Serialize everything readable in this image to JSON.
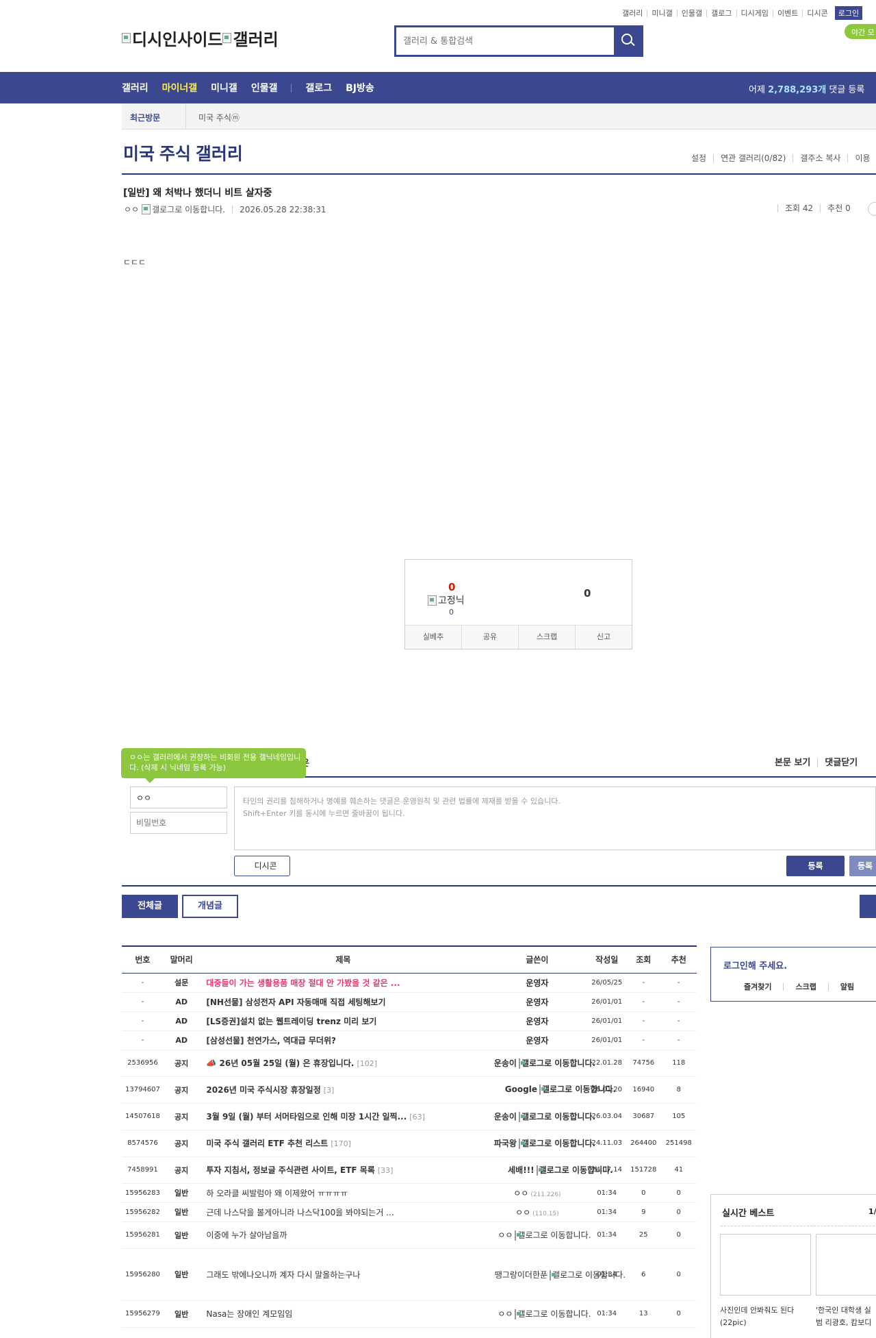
{
  "util_links": [
    "갤러리",
    "미니갤",
    "인물갤",
    "갤로그",
    "디시게임",
    "이벤트",
    "디시콘"
  ],
  "login_label": "로그인",
  "night_mode": "야간 모",
  "logo_text": "디시인사이드",
  "logo_text2": "갤러리",
  "search": {
    "placeholder": "갤러리 & 통합검색"
  },
  "gnb": {
    "items": [
      "갤러리",
      "마이너갤",
      "미니갤",
      "인물갤",
      "갤로그",
      "BJ방송"
    ],
    "yesterday_prefix": "어제",
    "yesterday_count": "2,788,293개",
    "yesterday_suffix": "댓글 등록"
  },
  "recent_visit": {
    "label": "최근방문",
    "item": "미국 주식ⓜ"
  },
  "gallery": {
    "title": "미국 주식 갤러리",
    "tools": [
      "설정",
      "연관 갤러리(0/82)",
      "갤주소 복사",
      "이용"
    ]
  },
  "post": {
    "title": "[일반] 왜 처박나 했더니 비트 살자중",
    "author": "ㅇㅇ",
    "author_img_alt": "갤로그로 이동합니다.",
    "date": "2026.05.28 22:38:31",
    "views": "조회 42",
    "recommend": "추천 0",
    "body": "ㄷㄷㄷ"
  },
  "recommend_box": {
    "up": "0",
    "fixed_label": "고정닉",
    "fixed_count": "0",
    "down": "0",
    "buttons": [
      "실베추",
      "공유",
      "스크랩",
      "신고"
    ]
  },
  "comment": {
    "partial_header": "은",
    "tooltip": "ㅇㅇ는 갤러리에서 권장하는 비회원 전용 갤닉네임입니다. (삭제 시 닉네임 등록 가능)",
    "header_right": [
      "본문 보기",
      "댓글닫기"
    ],
    "nick_value": "ㅇㅇ",
    "pw_placeholder": "비밀번호",
    "notice_line1": "타인의 권리를 침해하거나 명예를 훼손하는 댓글은 운영원칙 및 관련 법률에 제재를 받을 수 있습니다.",
    "notice_line2": "Shift+Enter 키를 동시에 누르면 줄바꿈이 됩니다.",
    "dccon": "디시콘",
    "submit": "등록",
    "submit2": "등록"
  },
  "tabs": [
    "전체글",
    "개념글"
  ],
  "table": {
    "headers": [
      "번호",
      "말머리",
      "제목",
      "글쓴이",
      "작성일",
      "조회",
      "추천"
    ],
    "rows": [
      {
        "num": "-",
        "head": "설문",
        "subject": "대중들이 가는 생활용품 매장 절대 안 가봤을 것 같은 ...",
        "reply": "",
        "writer": "운영자",
        "wimg": "",
        "ip": "",
        "date": "26/05/25",
        "views": "-",
        "rec": "-",
        "type": "survey"
      },
      {
        "num": "-",
        "head": "AD",
        "subject": "[NH선물] 삼성전자 API 자동매매 직접 세팅해보기",
        "reply": "",
        "writer": "운영자",
        "wimg": "",
        "ip": "",
        "date": "26/01/01",
        "views": "-",
        "rec": "-",
        "type": "ad"
      },
      {
        "num": "-",
        "head": "AD",
        "subject": "[LS증권]설치 없는 웹트레이딩 trenz 미리 보기",
        "reply": "",
        "writer": "운영자",
        "wimg": "",
        "ip": "",
        "date": "26/01/01",
        "views": "-",
        "rec": "-",
        "type": "ad"
      },
      {
        "num": "-",
        "head": "AD",
        "subject": "[삼성선물] 천연가스, 역대급 무더위?",
        "reply": "",
        "writer": "운영자",
        "wimg": "",
        "ip": "",
        "date": "26/01/01",
        "views": "-",
        "rec": "-",
        "type": "ad"
      },
      {
        "num": "2536956",
        "head": "공지",
        "subject": "📣 26년 05월 25일 (월) 은 휴장입니다.",
        "reply": "[102]",
        "writer": "운송이",
        "wimg": "갤로그로 이동합니다.",
        "ip": "",
        "date": "22.01.28",
        "views": "74756",
        "rec": "118",
        "type": "notice"
      },
      {
        "num": "13794607",
        "head": "공지",
        "subject": "2026년 미국 주식시장 휴장일정",
        "reply": "[3]",
        "writer": "Google",
        "wimg": "갤로그로 이동합니다.",
        "ip": "",
        "date": "26.01.20",
        "views": "16940",
        "rec": "8",
        "type": "notice"
      },
      {
        "num": "14507618",
        "head": "공지",
        "subject": "3월 9일 (월) 부터 서머타임으로 인해 미장 1시간 일찍...",
        "reply": "[63]",
        "writer": "운송이",
        "wimg": "갤로그로 이동합니다.",
        "ip": "",
        "date": "26.03.04",
        "views": "30687",
        "rec": "105",
        "type": "notice"
      },
      {
        "num": "8574576",
        "head": "공지",
        "subject": "미국 주식 갤러리 ETF 추천 리스트",
        "reply": "[170]",
        "writer": "파국왕",
        "wimg": "갤로그로 이동합니다.",
        "ip": "",
        "date": "24.11.03",
        "views": "264400",
        "rec": "251498",
        "type": "notice"
      },
      {
        "num": "7458991",
        "head": "공지",
        "subject": "투자 지침서, 정보글 주식관련 사이트, ETF 목록",
        "reply": "[33]",
        "writer": "세배!!!",
        "wimg": "갤로그로 이동합니다.",
        "ip": "",
        "date": "24.07.14",
        "views": "151728",
        "rec": "41",
        "type": "notice"
      },
      {
        "num": "15956283",
        "head": "일반",
        "subject": "하 오라클 씨발럼아 왜 이제왔어 ㅠㅠㅠㅠ",
        "reply": "",
        "writer": "ㅇㅇ",
        "wimg": "",
        "ip": "(211.226)",
        "date": "01:34",
        "views": "0",
        "rec": "0",
        "type": "normal"
      },
      {
        "num": "15956282",
        "head": "일반",
        "subject": "근데 나스닥을 볼게아니라 나스닥100을 봐야되는거 ...",
        "reply": "",
        "writer": "ㅇㅇ",
        "wimg": "",
        "ip": "(110.15)",
        "date": "01:34",
        "views": "9",
        "rec": "0",
        "type": "normal"
      },
      {
        "num": "15956281",
        "head": "일반",
        "subject": "이중에 누가 살아남을까",
        "reply": "",
        "writer": "ㅇㅇ",
        "wimg": "갤로그로 이동합니다.",
        "ip": "",
        "date": "01:34",
        "views": "25",
        "rec": "0",
        "type": "normal"
      },
      {
        "num": "15956280",
        "head": "일반",
        "subject": "그래도 밖에나오니까 계자 다시 말올하는구나",
        "reply": "",
        "writer": "땡그랑이더한푼",
        "wimg": "갤로그로 이동합니다.",
        "ip": "",
        "date": "01:34",
        "views": "6",
        "rec": "0",
        "type": "normal"
      },
      {
        "num": "15956279",
        "head": "일반",
        "subject": "Nasa는 장애인 계모임임",
        "reply": "",
        "writer": "ㅇㅇ",
        "wimg": "갤로그로 이동합니다.",
        "ip": "",
        "date": "01:34",
        "views": "13",
        "rec": "0",
        "type": "normal"
      }
    ]
  },
  "sidebar": {
    "login_title": "로그인해 주세요.",
    "login_links": [
      "즐겨찾기",
      "스크랩",
      "알림"
    ],
    "best_title": "실시간 베스트",
    "best_page": "1/",
    "best_items": [
      {
        "caption1": "사진인데 안봐줘도 된다",
        "caption2": "(22pic)"
      },
      {
        "caption1": "'한국인 대학생 실",
        "caption2": "범 리광호, 캄보디"
      }
    ]
  }
}
